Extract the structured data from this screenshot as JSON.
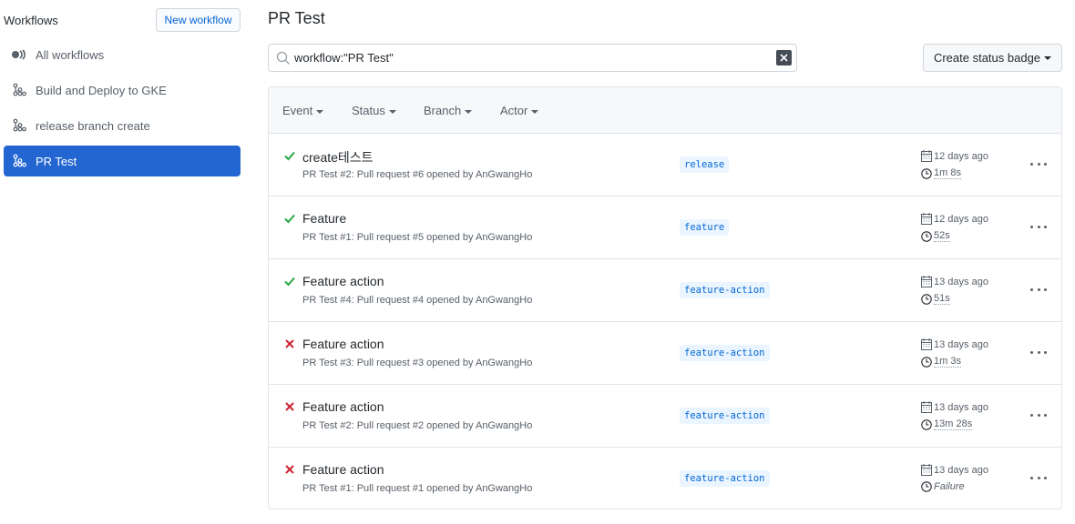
{
  "sidebar": {
    "heading": "Workflows",
    "new_workflow_label": "New workflow",
    "items": [
      {
        "label": "All workflows",
        "icon": "all-workflows-icon"
      },
      {
        "label": "Build and Deploy to GKE",
        "icon": "workflow-icon"
      },
      {
        "label": "release branch create",
        "icon": "workflow-icon"
      },
      {
        "label": "PR Test",
        "icon": "workflow-icon",
        "active": true
      }
    ]
  },
  "main": {
    "title": "PR Test",
    "search_value": "workflow:\"PR Test\"",
    "status_badge_label": "Create status badge",
    "filters": [
      "Event",
      "Status",
      "Branch",
      "Actor"
    ]
  },
  "runs": [
    {
      "status": "success",
      "title": "create테스트",
      "subtitle": "PR Test #2: Pull request #6 opened by AnGwangHo",
      "branch": "release",
      "when": "12 days ago",
      "duration": "1m 8s"
    },
    {
      "status": "success",
      "title": "Feature",
      "subtitle": "PR Test #1: Pull request #5 opened by AnGwangHo",
      "branch": "feature",
      "when": "12 days ago",
      "duration": "52s"
    },
    {
      "status": "success",
      "title": "Feature action",
      "subtitle": "PR Test #4: Pull request #4 opened by AnGwangHo",
      "branch": "feature-action",
      "when": "13 days ago",
      "duration": "51s"
    },
    {
      "status": "failure",
      "title": "Feature action",
      "subtitle": "PR Test #3: Pull request #3 opened by AnGwangHo",
      "branch": "feature-action",
      "when": "13 days ago",
      "duration": "1m 3s"
    },
    {
      "status": "failure",
      "title": "Feature action",
      "subtitle": "PR Test #2: Pull request #2 opened by AnGwangHo",
      "branch": "feature-action",
      "when": "13 days ago",
      "duration": "13m 28s"
    },
    {
      "status": "failure",
      "title": "Feature action",
      "subtitle": "PR Test #1: Pull request #1 opened by AnGwangHo",
      "branch": "feature-action",
      "when": "13 days ago",
      "duration": "Failure"
    }
  ],
  "colors": {
    "accent": "#2366d1",
    "success": "#28a745",
    "failure": "#cb2431",
    "link": "#0366d6"
  }
}
